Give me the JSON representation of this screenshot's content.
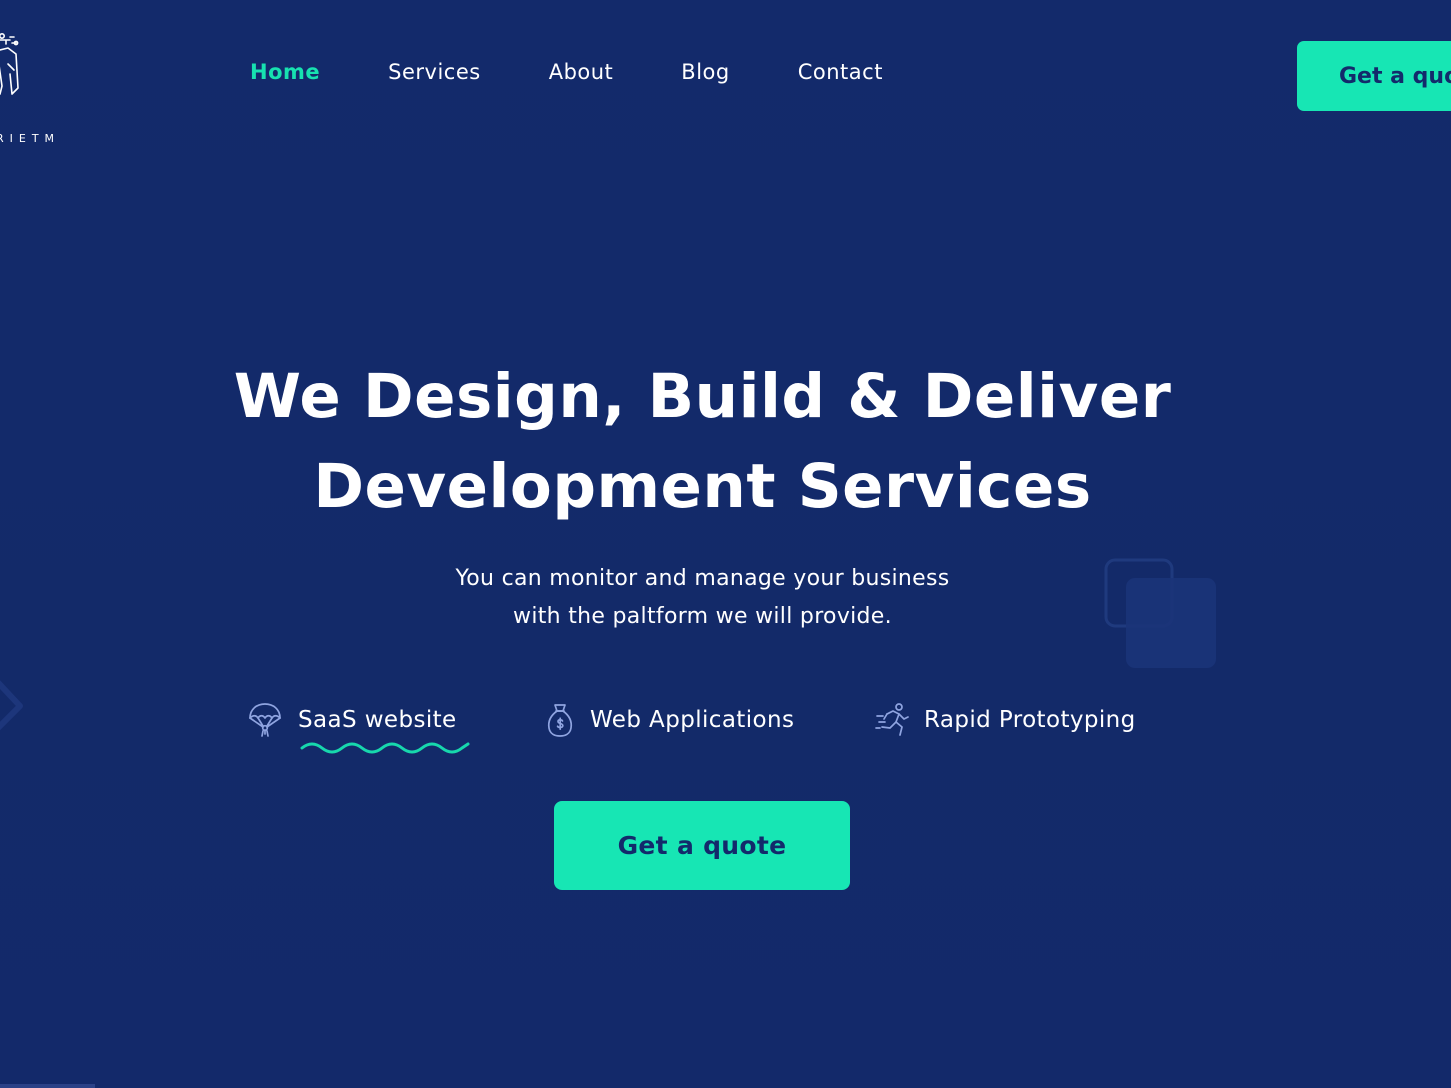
{
  "brand": {
    "logo_text": "RIETM",
    "logo_icon": "builder-logo-icon"
  },
  "nav": {
    "items": [
      {
        "label": "Home",
        "active": true
      },
      {
        "label": "Services",
        "active": false
      },
      {
        "label": "About",
        "active": false
      },
      {
        "label": "Blog",
        "active": false
      },
      {
        "label": "Contact",
        "active": false
      }
    ],
    "cta_label": "Get a quo"
  },
  "hero": {
    "title_line1": "We Design, Build & Deliver",
    "title_line2": "Development Services",
    "subtitle_line1": "You can monitor and manage your business",
    "subtitle_line2": "with the paltform we will provide.",
    "features": [
      {
        "label": "SaaS website",
        "icon": "parachute-icon",
        "selected": true
      },
      {
        "label": "Web Applications",
        "icon": "money-bag-icon",
        "selected": false
      },
      {
        "label": "Rapid Prototyping",
        "icon": "running-person-icon",
        "selected": false
      }
    ],
    "cta_label": "Get a quote"
  },
  "colors": {
    "background": "#132a6b",
    "accent": "#17e6b4",
    "text": "#ffffff"
  }
}
